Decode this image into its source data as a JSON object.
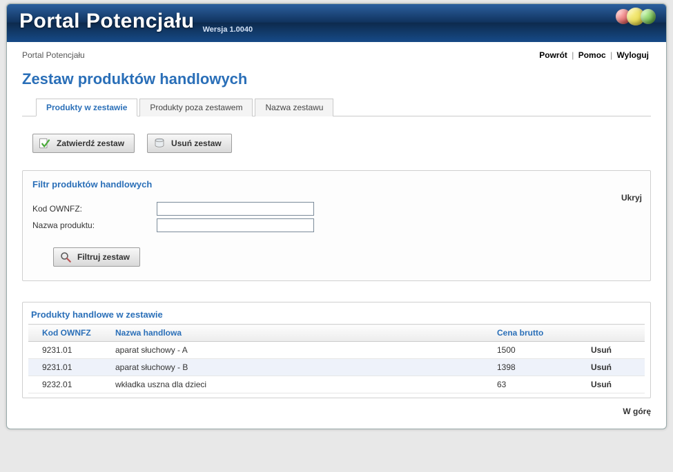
{
  "header": {
    "app_title": "Portal Potencjału",
    "version": "Wersja 1.0040"
  },
  "breadcrumb": "Portal Potencjału",
  "toplinks": {
    "back": "Powrót",
    "help": "Pomoc",
    "logout": "Wyloguj"
  },
  "page_title": "Zestaw produktów handlowych",
  "tabs": [
    {
      "label": "Produkty w zestawie",
      "active": true
    },
    {
      "label": "Produkty poza zestawem",
      "active": false
    },
    {
      "label": "Nazwa zestawu",
      "active": false
    }
  ],
  "buttons": {
    "confirm": "Zatwierdź zestaw",
    "delete": "Usuń zestaw",
    "filter": "Filtruj zestaw"
  },
  "filter_panel": {
    "title": "Filtr produktów handlowych",
    "hide": "Ukryj",
    "kod_label": "Kod OWNFZ:",
    "nazwa_label": "Nazwa produktu:",
    "kod_value": "",
    "nazwa_value": ""
  },
  "products_panel": {
    "title": "Produkty handlowe w zestawie",
    "headers": {
      "kod": "Kod OWNFZ",
      "nazwa": "Nazwa handlowa",
      "cena": "Cena brutto",
      "action": ""
    },
    "rows": [
      {
        "kod": "9231.01",
        "nazwa": "aparat słuchowy - A",
        "cena": "1500",
        "action": "Usuń"
      },
      {
        "kod": "9231.01",
        "nazwa": "aparat słuchowy - B",
        "cena": "1398",
        "action": "Usuń"
      },
      {
        "kod": "9232.01",
        "nazwa": "wkładka uszna dla dzieci",
        "cena": "63",
        "action": "Usuń"
      }
    ]
  },
  "footer": {
    "top": "W górę"
  }
}
